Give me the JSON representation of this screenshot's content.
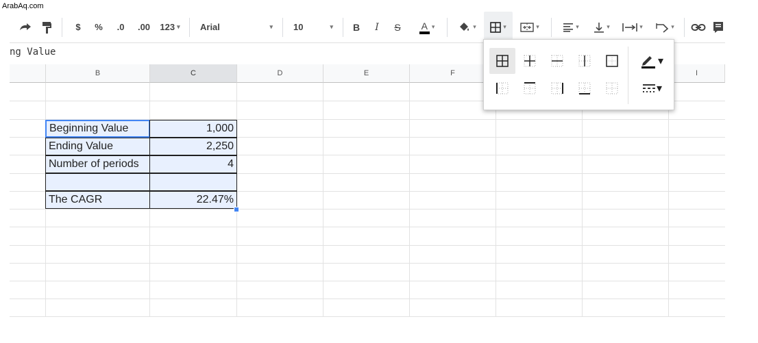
{
  "watermark": "ArabAq.com",
  "toolbar": {
    "currency": "$",
    "percent": "%",
    "decrease_decimal": ".0",
    "increase_decimal": ".00",
    "more_formats": "123",
    "font_family": "Arial",
    "font_size": "10",
    "bold": "B",
    "italic": "I",
    "strikethrough": "S",
    "text_color": "A"
  },
  "formula_bar": {
    "content": "ng Value"
  },
  "columns": [
    "B",
    "C",
    "D",
    "E",
    "F",
    "I"
  ],
  "table": {
    "rows": [
      {
        "label": "Beginning Value",
        "value": "1,000"
      },
      {
        "label": "Ending Value",
        "value": "2,250"
      },
      {
        "label": "Number of periods",
        "value": "4"
      },
      {
        "label": "",
        "value": ""
      },
      {
        "label": "The CAGR",
        "value": "22.47%"
      }
    ]
  },
  "borders_menu": {
    "options": [
      "all-borders",
      "inner-borders",
      "horizontal-borders",
      "vertical-borders",
      "outer-borders",
      "left-border",
      "top-border",
      "right-border",
      "bottom-border",
      "clear-borders"
    ],
    "border_color_icon": "pencil-icon",
    "border_style_icon": "line-style-icon"
  },
  "colors": {
    "selection_fill": "#e8f0fe",
    "active_border": "#4285f4",
    "header_bg": "#f8f9fa"
  }
}
